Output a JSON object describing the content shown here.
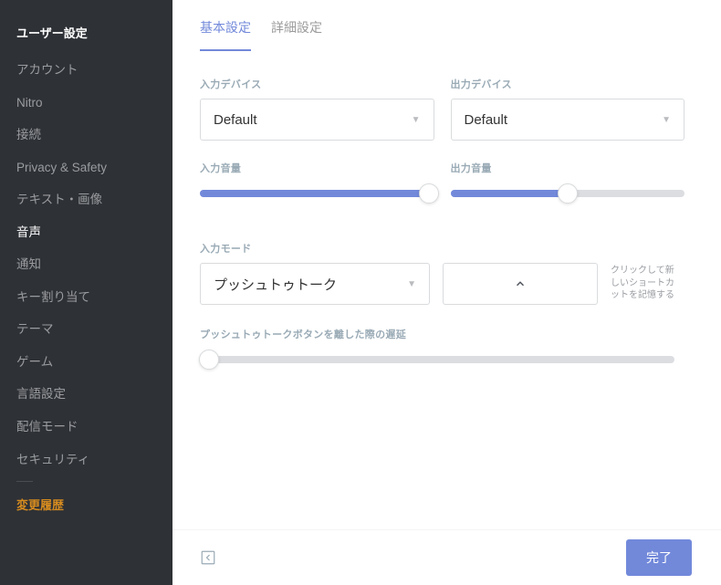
{
  "sidebar": {
    "title": "ユーザー設定",
    "items": [
      {
        "label": "アカウント",
        "active": false
      },
      {
        "label": "Nitro",
        "active": false
      },
      {
        "label": "接続",
        "active": false
      },
      {
        "label": "Privacy & Safety",
        "active": false
      },
      {
        "label": "テキスト・画像",
        "active": false
      },
      {
        "label": "音声",
        "active": true
      },
      {
        "label": "通知",
        "active": false
      },
      {
        "label": "キー割り当て",
        "active": false
      },
      {
        "label": "テーマ",
        "active": false
      },
      {
        "label": "ゲーム",
        "active": false
      },
      {
        "label": "言語設定",
        "active": false
      },
      {
        "label": "配信モード",
        "active": false
      },
      {
        "label": "セキュリティ",
        "active": false
      }
    ],
    "changelog_label": "変更履歴"
  },
  "tabs": {
    "basic": "基本設定",
    "advanced": "詳細設定",
    "active": "basic"
  },
  "input_device": {
    "label": "入力デバイス",
    "value": "Default"
  },
  "output_device": {
    "label": "出力デバイス",
    "value": "Default"
  },
  "input_volume": {
    "label": "入力音量",
    "percent": 98
  },
  "output_volume": {
    "label": "出力音量",
    "percent": 50
  },
  "input_mode": {
    "label": "入力モード",
    "value": "プッシュトゥトーク",
    "shortcut_help": "クリックして新しいショートカットを記憶する"
  },
  "ptt_delay": {
    "label": "プッシュトゥトークボタンを離した際の遅延",
    "percent": 2
  },
  "footer": {
    "done": "完了"
  },
  "colors": {
    "accent": "#7289da",
    "sidebar_bg": "#2e3136"
  }
}
